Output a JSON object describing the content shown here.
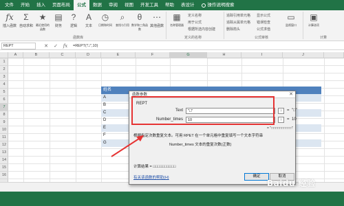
{
  "ribbon": {
    "tabs": [
      "文件",
      "开始",
      "插入",
      "页面布局",
      "公式",
      "数据",
      "审阅",
      "视图",
      "开发工具",
      "帮助",
      "表设计"
    ],
    "active_tab": "公式",
    "search_label": "操作说明搜索",
    "buttons": {
      "insert_function": "插入函数",
      "autosum": "自动求和",
      "recent": "最近使用的函数",
      "financial": "财务",
      "logical": "逻辑",
      "text": "文本",
      "datetime": "日期和时间",
      "lookup": "查找与引用",
      "math": "数学和三角函数",
      "more": "其他函数",
      "name_manager": "名称管理器",
      "define_name": "定义名称",
      "use_in_formula": "用于公式",
      "create_from_selection": "根据所选内容创建",
      "trace_precedents": "追踪引用单元格",
      "trace_dependents": "追踪从属单元格",
      "remove_arrows": "删除箭头",
      "show_formulas": "显示公式",
      "error_checking": "错误检查",
      "evaluate": "公式求值",
      "watch_window": "监视窗口",
      "calc_options": "计算选项"
    },
    "groups": {
      "function_library": "函数库",
      "defined_names": "定义的名称",
      "formula_auditing": "公式审核",
      "calculation": "计算"
    }
  },
  "formula_bar": {
    "name_box": "REPT",
    "cancel": "✕",
    "enter": "✓",
    "fx": "fx",
    "formula": "=REPT(\"□\",10)"
  },
  "grid": {
    "columns": [
      "A",
      "B",
      "C",
      "D",
      "E",
      "F",
      "G",
      "H",
      "I",
      "J"
    ],
    "selected_column": "G",
    "rows": [
      "1",
      "2",
      "3",
      "4",
      "5",
      "6",
      "7",
      "8",
      "9",
      "10",
      "11",
      "12",
      "13",
      "14",
      "15",
      "16"
    ],
    "selected_row": "7",
    "table_header": "姓名",
    "names": [
      "A",
      "B",
      "C",
      "D",
      "E",
      "F",
      "G"
    ]
  },
  "dialog": {
    "title": "函数参数",
    "close": "✕",
    "function_name": "REPT",
    "arg1_label": "Text",
    "arg1_value": "\"□\"",
    "arg1_result": "\"□\"",
    "arg2_label": "Number_times",
    "arg2_value": "10",
    "arg2_result": "10",
    "equals": "=",
    "ref_icon": "↑",
    "preview_result": "= \"□□□□□□□□□□\"",
    "description": "根据指定次数重复文本。可用 RPET 在一个单元格中重复填写一个文本字符串",
    "arg_description": "Number_times   文本的重复次数(正数)",
    "calc_result": "计算结果 =  □□□□□□□□□□",
    "help_link": "有关该函数的帮助(H)",
    "ok": "确定",
    "cancel": "取消"
  },
  "watermark": "Baidu 经验",
  "colors": {
    "excel_green": "#217346",
    "table_blue": "#4f81bd",
    "annotation_red": "#e63333"
  }
}
